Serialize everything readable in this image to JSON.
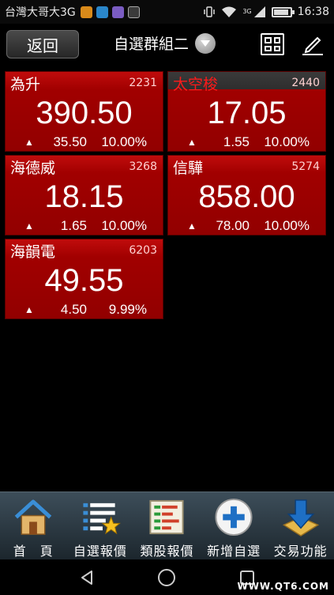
{
  "status_bar": {
    "carrier": "台灣大哥大3G",
    "network": "3G",
    "time": "16:38",
    "battery_level": 0.82
  },
  "toolbar": {
    "back_label": "返回",
    "group_title": "自選群組二"
  },
  "stocks": [
    {
      "name": "為升",
      "code": "2231",
      "price": "390.50",
      "change": "35.50",
      "percent": "10.00%",
      "direction": "up"
    },
    {
      "name": "太空梭",
      "code": "2440",
      "price": "17.05",
      "change": "1.55",
      "percent": "10.00%",
      "direction": "up"
    },
    {
      "name": "海德威",
      "code": "3268",
      "price": "18.15",
      "change": "1.65",
      "percent": "10.00%",
      "direction": "up"
    },
    {
      "name": "信驊",
      "code": "5274",
      "price": "858.00",
      "change": "78.00",
      "percent": "10.00%",
      "direction": "up"
    },
    {
      "name": "海韻電",
      "code": "6203",
      "price": "49.55",
      "change": "4.50",
      "percent": "9.99%",
      "direction": "up"
    }
  ],
  "bottom_nav": [
    {
      "label": "首　頁",
      "icon": "home-icon"
    },
    {
      "label": "自選報價",
      "icon": "watchlist-star-icon"
    },
    {
      "label": "類股報價",
      "icon": "sector-list-icon"
    },
    {
      "label": "新增自選",
      "icon": "add-plus-icon"
    },
    {
      "label": "交易功能",
      "icon": "trade-download-icon"
    }
  ],
  "watermark": "WWW.QT6.COM",
  "colors": {
    "tile_red": "#a10000",
    "tile_header_red": "#c00c0c",
    "inactive_name_red": "#ff1a1a",
    "nav_bar": "#2c3a44"
  }
}
